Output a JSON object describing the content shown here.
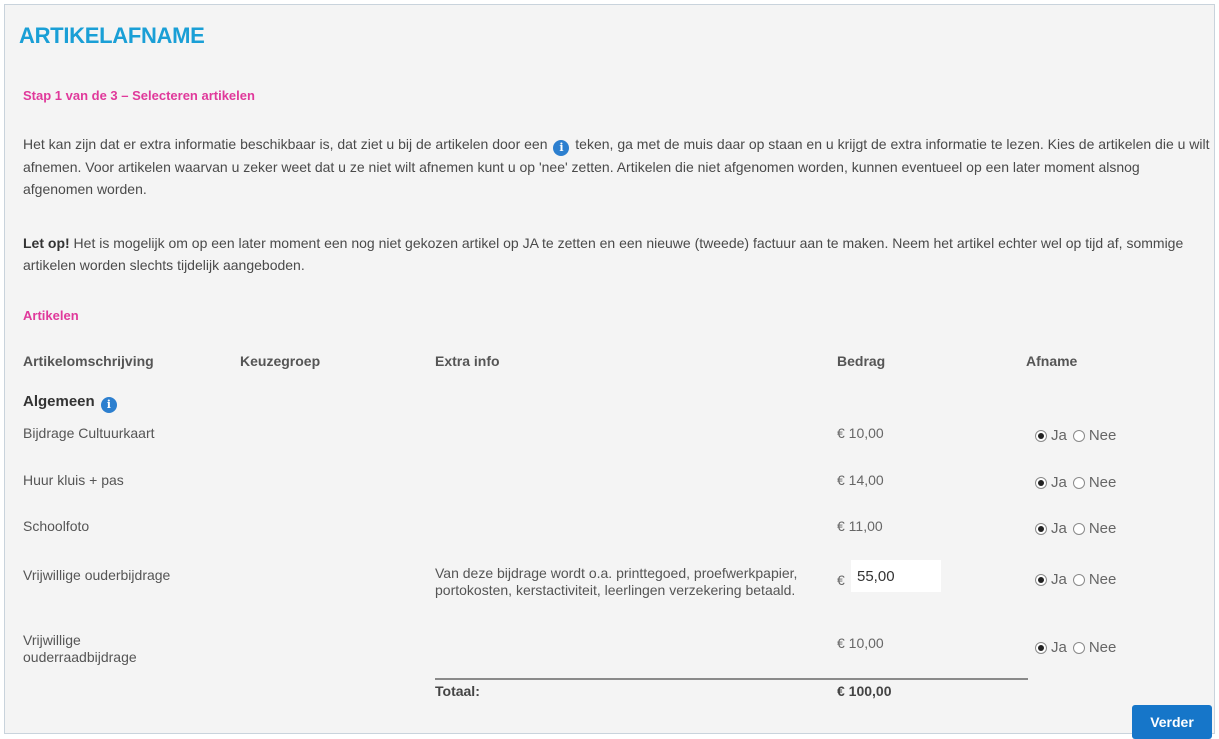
{
  "page": {
    "title": "ARTIKELAFNAME",
    "step": "Stap 1 van de 3 – Selecteren artikelen",
    "intro_before_icon": "Het kan zijn dat er extra informatie beschikbaar is, dat ziet u bij de artikelen door een",
    "intro_after_icon": "teken, ga met de muis daar op staan en u krijgt de extra informatie te lezen. Kies de artikelen die u wilt afnemen. Voor artikelen waarvan u zeker weet dat u ze niet wilt afnemen kunt u op 'nee' zetten. Artikelen die niet afgenomen worden, kunnen eventueel op een later moment alsnog afgenomen worden.",
    "note_bold": "Let op!",
    "note_text": "Het is mogelijk om op een later moment een nog niet gekozen artikel op JA te zetten en een nieuwe (tweede) factuur aan te maken. Neem het artikel echter wel op tijd af, sommige artikelen worden slechts tijdelijk aangeboden.",
    "section_title": "Artikelen"
  },
  "table": {
    "headers": [
      "Artikelomschrijving",
      "Keuzegroep",
      "Extra info",
      "Bedrag",
      "Afname"
    ],
    "group": "Algemeen",
    "rows": [
      {
        "name": "Bijdrage Cultuurkaart",
        "amount": "€ 10,00",
        "choice": "Ja"
      },
      {
        "name": "Huur kluis + pas",
        "amount": "€ 14,00",
        "choice": "Ja"
      },
      {
        "name": "Schoolfoto",
        "amount": "€ 11,00",
        "choice": "Ja"
      },
      {
        "name": "Vrijwillige ouderbijdrage",
        "currency": "€",
        "input_value": "55,00",
        "extra": "Van deze bijdrage wordt o.a. printtegoed, proefwerkpapier, portokosten, kerstactiviteit, leerlingen verzekering betaald.",
        "choice": "Ja"
      },
      {
        "name_line1": "Vrijwillige",
        "name_line2": "ouderraadbijdrage",
        "amount": "€ 10,00",
        "choice": "Ja"
      }
    ],
    "radio_yes": "Ja",
    "radio_no": "Nee",
    "total_label": "Totaal:",
    "total_value": "€ 100,00"
  },
  "buttons": {
    "next": "Verder"
  },
  "icons": {
    "info": "info-icon",
    "info_glyph": "i"
  },
  "colors": {
    "title": "#1a9fd6",
    "accent_pink": "#e0399b",
    "button": "#1676c9"
  }
}
